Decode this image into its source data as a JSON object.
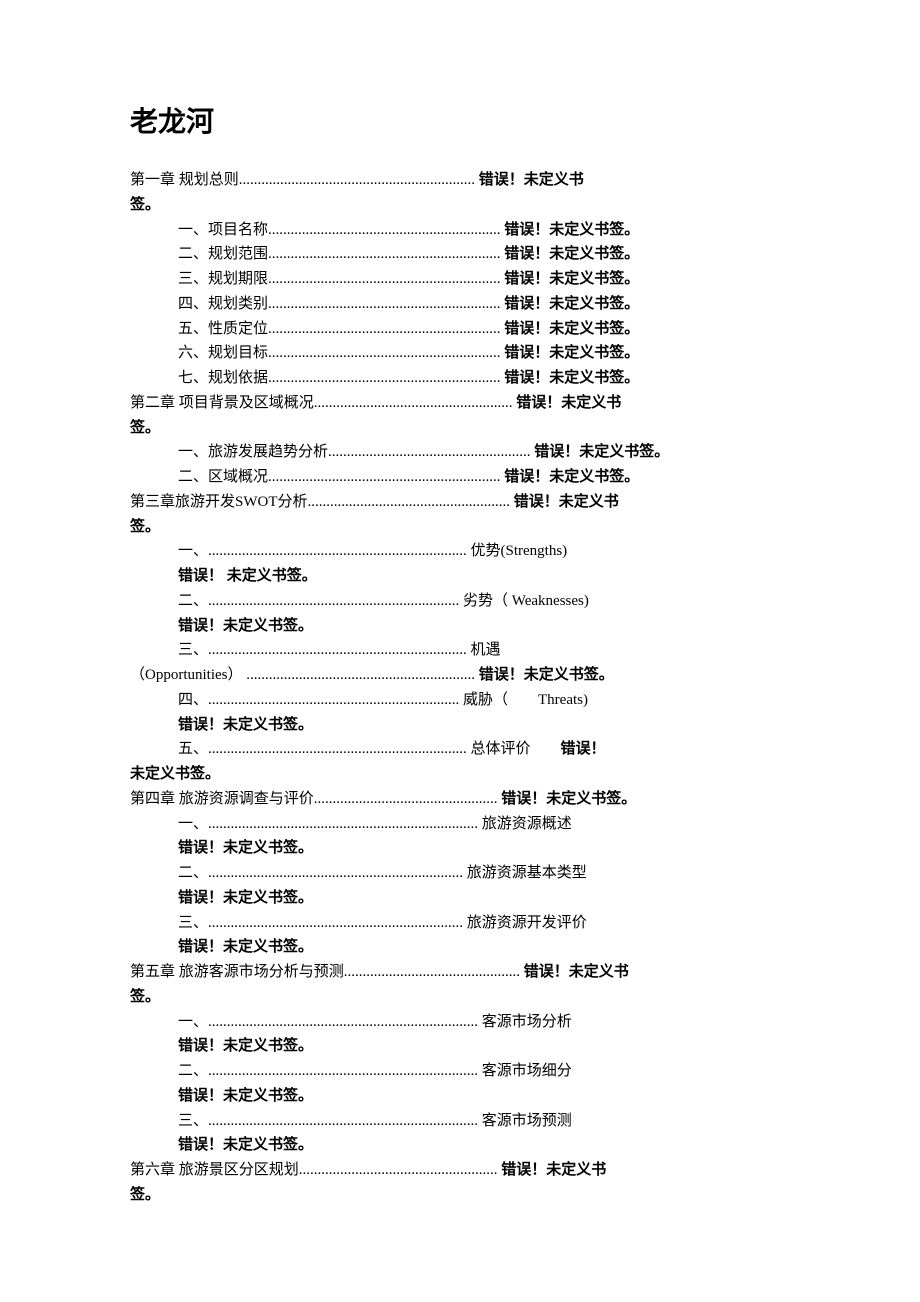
{
  "title": "老龙河",
  "errorText": "错误！未定义书签。",
  "errorTextShort": "错误！",
  "errorTextNoBookmark": "未定义书签。",
  "errorTextSpaced": "错误！ 未定义书签。",
  "toc": {
    "ch1": {
      "title": "第一章 规划总则",
      "cont": "签。",
      "items": {
        "i1": "一、项目名称",
        "i2": "二、规划范围",
        "i3": "三、规划期限",
        "i4": "四、规划类别",
        "i5": "五、性质定位",
        "i6": "六、规划目标",
        "i7": "七、规划依据"
      }
    },
    "ch2": {
      "title": "第二章 项目背景及区域概况",
      "cont": "签。",
      "items": {
        "i1": "一、旅游发展趋势分析",
        "i2": "二、区域概况"
      }
    },
    "ch3": {
      "title": "第三章旅游开发SWOT分析",
      "cont": "签。",
      "items": {
        "i1_prefix": "一、",
        "i1_right": "优势(Strengths)",
        "i2_prefix": "二、",
        "i2_right": "劣势（ Weaknesses)",
        "i3_prefix": "三、",
        "i3_right": "机遇",
        "i3_opp": "（Opportunities）",
        "i4_prefix": "四、",
        "i4_right": "威胁（　　Threats)",
        "i5_prefix": "五、",
        "i5_right": "总体评价"
      }
    },
    "ch4": {
      "title": "第四章 旅游资源调查与评价",
      "items": {
        "i1_prefix": "一、",
        "i1_right": "旅游资源概述",
        "i2_prefix": "二、",
        "i2_right": "旅游资源基本类型",
        "i3_prefix": "三、",
        "i3_right": "旅游资源开发评价"
      }
    },
    "ch5": {
      "title": "第五章 旅游客源市场分析与预测",
      "cont": "签。",
      "items": {
        "i1_prefix": "一、",
        "i1_right": "客源市场分析",
        "i2_prefix": "二、",
        "i2_right": "客源市场细分",
        "i3_prefix": "三、",
        "i3_right": "客源市场预测"
      }
    },
    "ch6": {
      "title": "第六章 旅游景区分区规划",
      "cont": "签。"
    }
  },
  "rightError": "错误！未定义书",
  "rightErrorFull": "错误！未定义书签。"
}
